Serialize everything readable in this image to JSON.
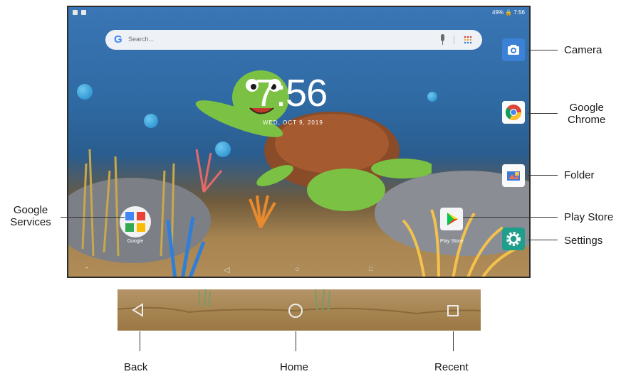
{
  "status": {
    "right_text": "49% 🔒 7:56"
  },
  "search": {
    "logo": "G",
    "placeholder": "Search..."
  },
  "clock": {
    "time": "7:56",
    "date": "WED, OCT 9, 2019"
  },
  "apps": {
    "google_label": "Google",
    "play_store_label": "Play Store"
  },
  "callouts": {
    "camera": "Camera",
    "chrome_line1": "Google",
    "chrome_line2": "Chrome",
    "folder": "Folder",
    "play_store": "Play Store",
    "settings": "Settings",
    "google_line1": "Google",
    "google_line2": "Services",
    "back": "Back",
    "home": "Home",
    "recent": "Recent"
  },
  "icons": {
    "back": "back-triangle-icon",
    "home": "home-circle-icon",
    "recent": "recent-square-icon",
    "camera": "camera-icon",
    "chrome": "chrome-icon",
    "folder": "folder-icon",
    "settings": "gear-icon",
    "play": "play-store-icon",
    "mic": "mic-icon",
    "apps": "app-grid-icon"
  },
  "colors": {
    "camera_bg": "#3b82d6",
    "settings_bg": "#1f9e8b",
    "search_bg": "#eef2f7"
  }
}
